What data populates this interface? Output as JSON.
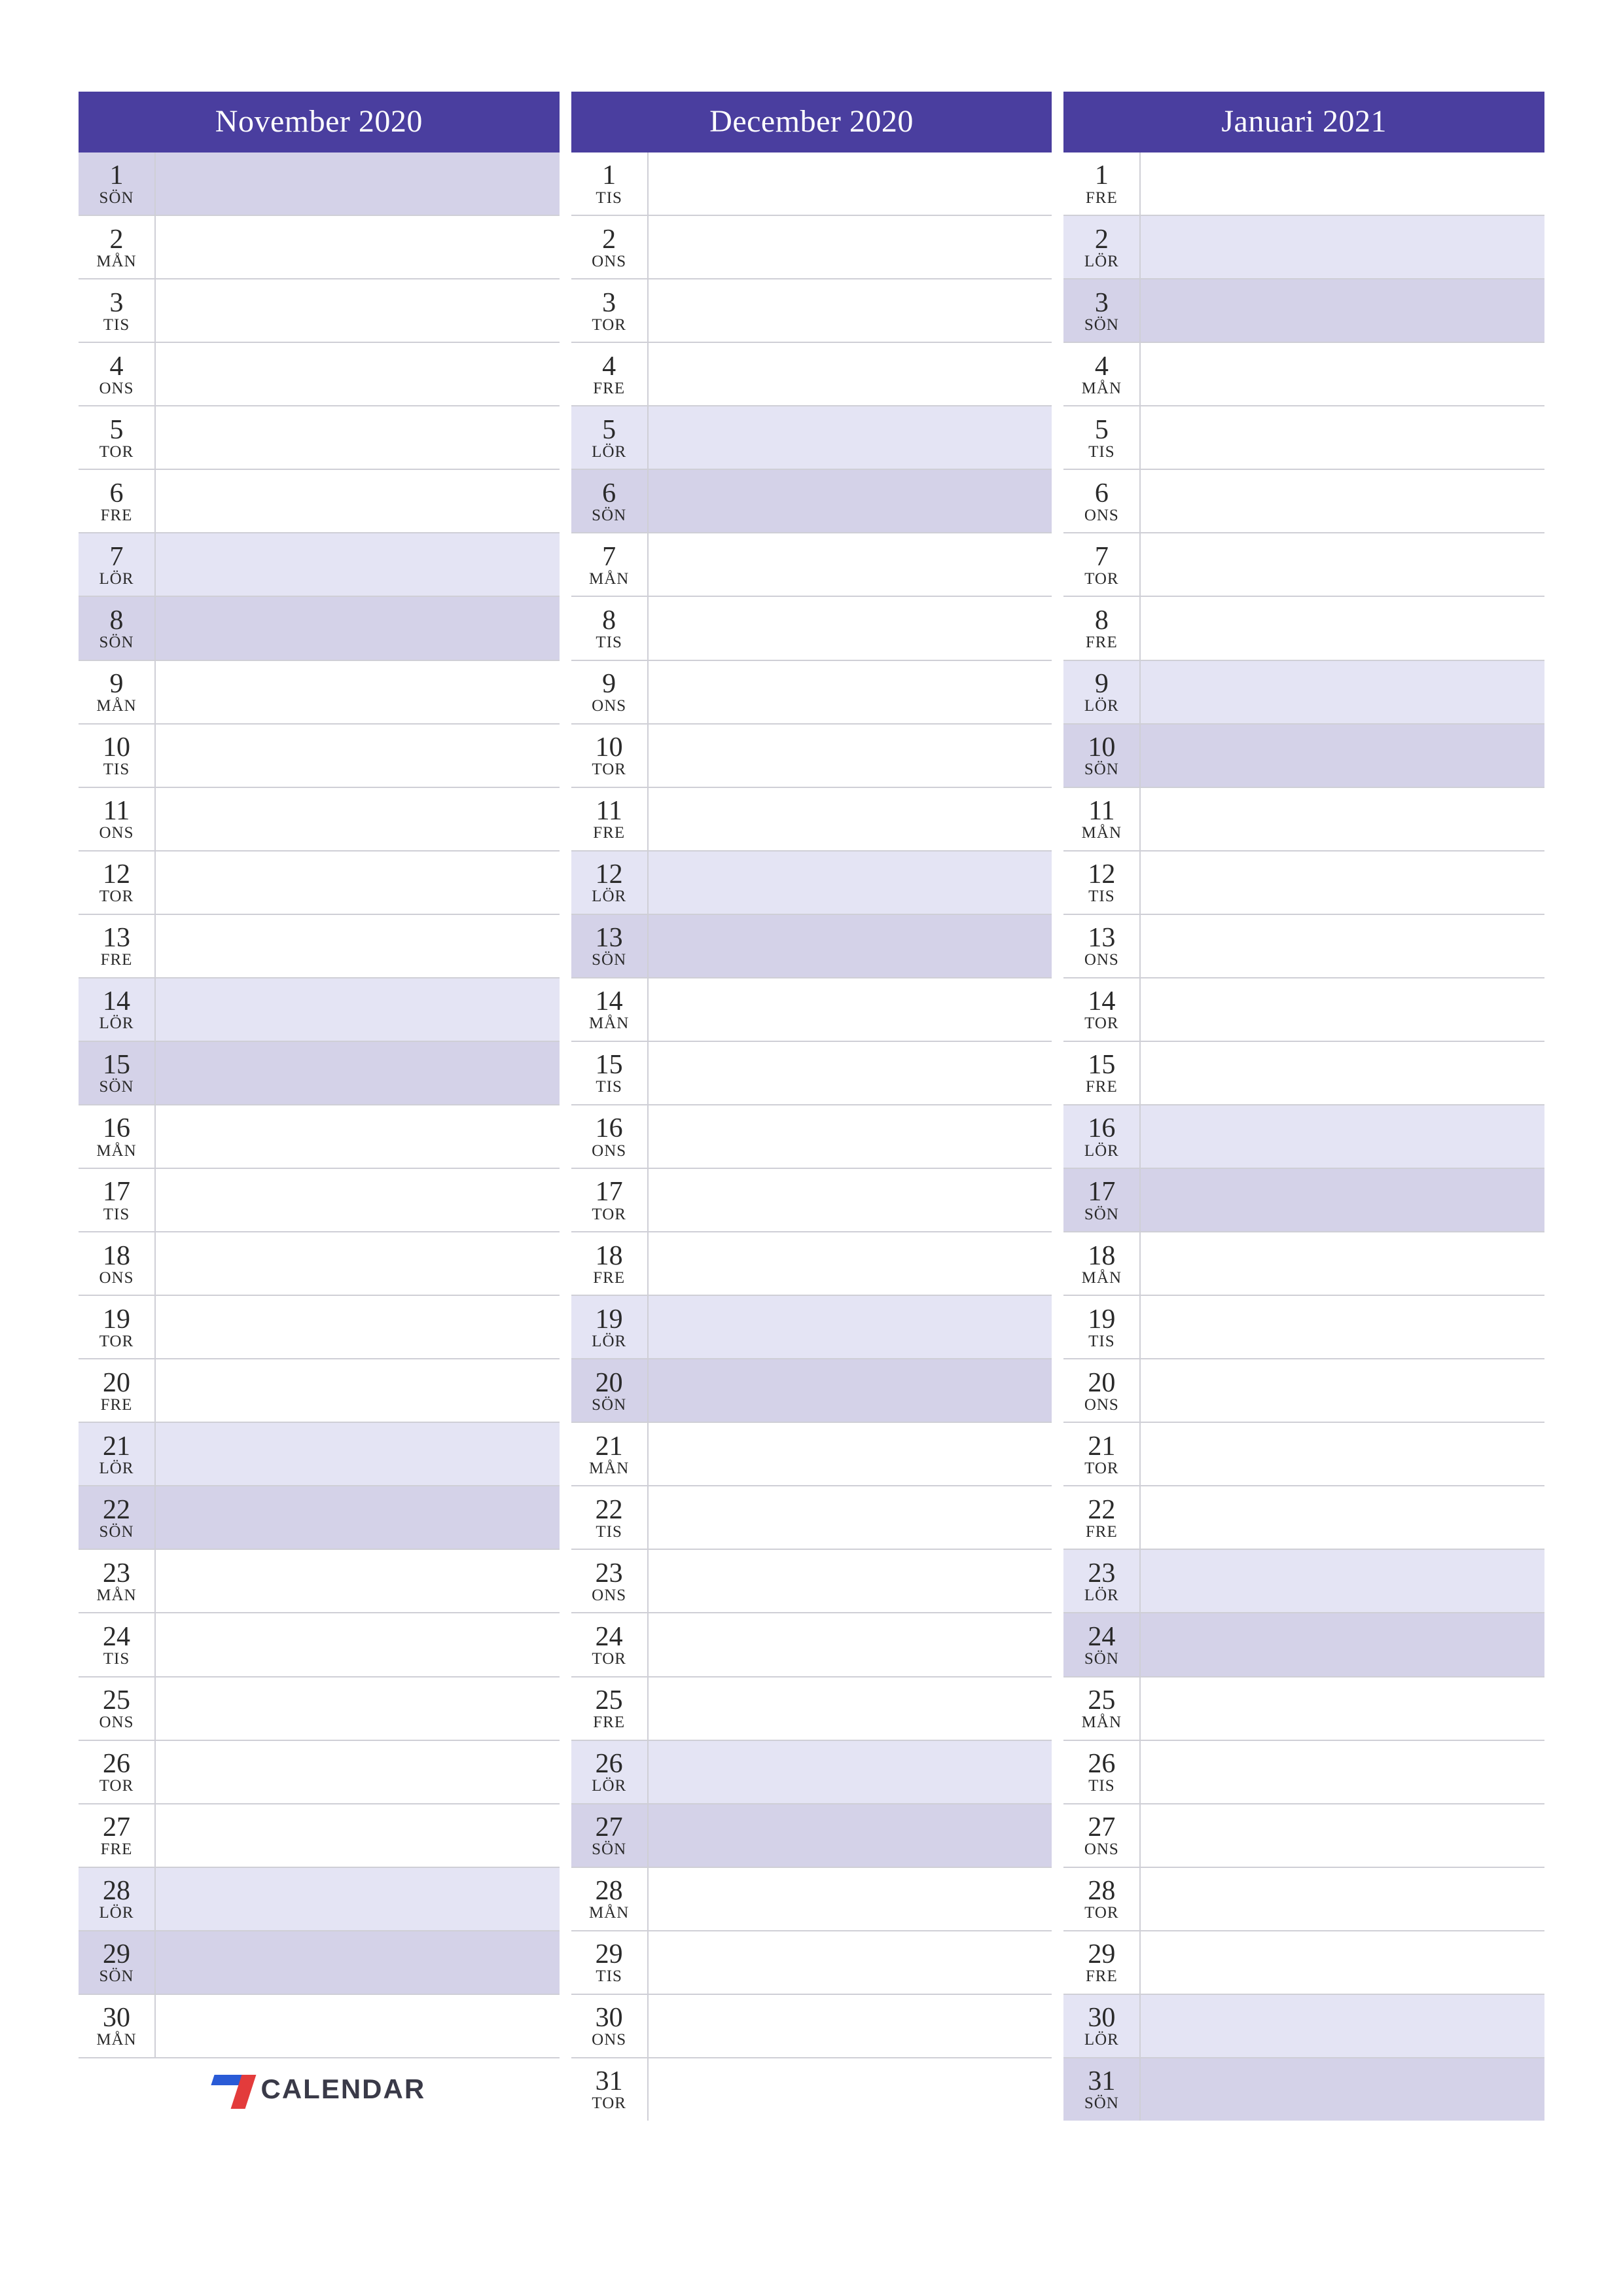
{
  "brand": {
    "name": "CALENDAR"
  },
  "colors": {
    "header_bg": "#4a3e9f",
    "sat_bg": "#e4e4f4",
    "sun_bg": "#d4d2e8"
  },
  "weekdays": {
    "mon": "MÅN",
    "tue": "TIS",
    "wed": "ONS",
    "thu": "TOR",
    "fri": "FRE",
    "sat": "LÖR",
    "sun": "SÖN"
  },
  "months": [
    {
      "title": "November 2020",
      "show_logo": true,
      "days": [
        {
          "n": 1,
          "w": "SÖN",
          "t": "sun"
        },
        {
          "n": 2,
          "w": "MÅN",
          "t": ""
        },
        {
          "n": 3,
          "w": "TIS",
          "t": ""
        },
        {
          "n": 4,
          "w": "ONS",
          "t": ""
        },
        {
          "n": 5,
          "w": "TOR",
          "t": ""
        },
        {
          "n": 6,
          "w": "FRE",
          "t": ""
        },
        {
          "n": 7,
          "w": "LÖR",
          "t": "sat"
        },
        {
          "n": 8,
          "w": "SÖN",
          "t": "sun"
        },
        {
          "n": 9,
          "w": "MÅN",
          "t": ""
        },
        {
          "n": 10,
          "w": "TIS",
          "t": ""
        },
        {
          "n": 11,
          "w": "ONS",
          "t": ""
        },
        {
          "n": 12,
          "w": "TOR",
          "t": ""
        },
        {
          "n": 13,
          "w": "FRE",
          "t": ""
        },
        {
          "n": 14,
          "w": "LÖR",
          "t": "sat"
        },
        {
          "n": 15,
          "w": "SÖN",
          "t": "sun"
        },
        {
          "n": 16,
          "w": "MÅN",
          "t": ""
        },
        {
          "n": 17,
          "w": "TIS",
          "t": ""
        },
        {
          "n": 18,
          "w": "ONS",
          "t": ""
        },
        {
          "n": 19,
          "w": "TOR",
          "t": ""
        },
        {
          "n": 20,
          "w": "FRE",
          "t": ""
        },
        {
          "n": 21,
          "w": "LÖR",
          "t": "sat"
        },
        {
          "n": 22,
          "w": "SÖN",
          "t": "sun"
        },
        {
          "n": 23,
          "w": "MÅN",
          "t": ""
        },
        {
          "n": 24,
          "w": "TIS",
          "t": ""
        },
        {
          "n": 25,
          "w": "ONS",
          "t": ""
        },
        {
          "n": 26,
          "w": "TOR",
          "t": ""
        },
        {
          "n": 27,
          "w": "FRE",
          "t": ""
        },
        {
          "n": 28,
          "w": "LÖR",
          "t": "sat"
        },
        {
          "n": 29,
          "w": "SÖN",
          "t": "sun"
        },
        {
          "n": 30,
          "w": "MÅN",
          "t": ""
        }
      ]
    },
    {
      "title": "December 2020",
      "show_logo": false,
      "days": [
        {
          "n": 1,
          "w": "TIS",
          "t": ""
        },
        {
          "n": 2,
          "w": "ONS",
          "t": ""
        },
        {
          "n": 3,
          "w": "TOR",
          "t": ""
        },
        {
          "n": 4,
          "w": "FRE",
          "t": ""
        },
        {
          "n": 5,
          "w": "LÖR",
          "t": "sat"
        },
        {
          "n": 6,
          "w": "SÖN",
          "t": "sun"
        },
        {
          "n": 7,
          "w": "MÅN",
          "t": ""
        },
        {
          "n": 8,
          "w": "TIS",
          "t": ""
        },
        {
          "n": 9,
          "w": "ONS",
          "t": ""
        },
        {
          "n": 10,
          "w": "TOR",
          "t": ""
        },
        {
          "n": 11,
          "w": "FRE",
          "t": ""
        },
        {
          "n": 12,
          "w": "LÖR",
          "t": "sat"
        },
        {
          "n": 13,
          "w": "SÖN",
          "t": "sun"
        },
        {
          "n": 14,
          "w": "MÅN",
          "t": ""
        },
        {
          "n": 15,
          "w": "TIS",
          "t": ""
        },
        {
          "n": 16,
          "w": "ONS",
          "t": ""
        },
        {
          "n": 17,
          "w": "TOR",
          "t": ""
        },
        {
          "n": 18,
          "w": "FRE",
          "t": ""
        },
        {
          "n": 19,
          "w": "LÖR",
          "t": "sat"
        },
        {
          "n": 20,
          "w": "SÖN",
          "t": "sun"
        },
        {
          "n": 21,
          "w": "MÅN",
          "t": ""
        },
        {
          "n": 22,
          "w": "TIS",
          "t": ""
        },
        {
          "n": 23,
          "w": "ONS",
          "t": ""
        },
        {
          "n": 24,
          "w": "TOR",
          "t": ""
        },
        {
          "n": 25,
          "w": "FRE",
          "t": ""
        },
        {
          "n": 26,
          "w": "LÖR",
          "t": "sat"
        },
        {
          "n": 27,
          "w": "SÖN",
          "t": "sun"
        },
        {
          "n": 28,
          "w": "MÅN",
          "t": ""
        },
        {
          "n": 29,
          "w": "TIS",
          "t": ""
        },
        {
          "n": 30,
          "w": "ONS",
          "t": ""
        },
        {
          "n": 31,
          "w": "TOR",
          "t": ""
        }
      ]
    },
    {
      "title": "Januari 2021",
      "show_logo": false,
      "days": [
        {
          "n": 1,
          "w": "FRE",
          "t": ""
        },
        {
          "n": 2,
          "w": "LÖR",
          "t": "sat"
        },
        {
          "n": 3,
          "w": "SÖN",
          "t": "sun"
        },
        {
          "n": 4,
          "w": "MÅN",
          "t": ""
        },
        {
          "n": 5,
          "w": "TIS",
          "t": ""
        },
        {
          "n": 6,
          "w": "ONS",
          "t": ""
        },
        {
          "n": 7,
          "w": "TOR",
          "t": ""
        },
        {
          "n": 8,
          "w": "FRE",
          "t": ""
        },
        {
          "n": 9,
          "w": "LÖR",
          "t": "sat"
        },
        {
          "n": 10,
          "w": "SÖN",
          "t": "sun"
        },
        {
          "n": 11,
          "w": "MÅN",
          "t": ""
        },
        {
          "n": 12,
          "w": "TIS",
          "t": ""
        },
        {
          "n": 13,
          "w": "ONS",
          "t": ""
        },
        {
          "n": 14,
          "w": "TOR",
          "t": ""
        },
        {
          "n": 15,
          "w": "FRE",
          "t": ""
        },
        {
          "n": 16,
          "w": "LÖR",
          "t": "sat"
        },
        {
          "n": 17,
          "w": "SÖN",
          "t": "sun"
        },
        {
          "n": 18,
          "w": "MÅN",
          "t": ""
        },
        {
          "n": 19,
          "w": "TIS",
          "t": ""
        },
        {
          "n": 20,
          "w": "ONS",
          "t": ""
        },
        {
          "n": 21,
          "w": "TOR",
          "t": ""
        },
        {
          "n": 22,
          "w": "FRE",
          "t": ""
        },
        {
          "n": 23,
          "w": "LÖR",
          "t": "sat"
        },
        {
          "n": 24,
          "w": "SÖN",
          "t": "sun"
        },
        {
          "n": 25,
          "w": "MÅN",
          "t": ""
        },
        {
          "n": 26,
          "w": "TIS",
          "t": ""
        },
        {
          "n": 27,
          "w": "ONS",
          "t": ""
        },
        {
          "n": 28,
          "w": "TOR",
          "t": ""
        },
        {
          "n": 29,
          "w": "FRE",
          "t": ""
        },
        {
          "n": 30,
          "w": "LÖR",
          "t": "sat"
        },
        {
          "n": 31,
          "w": "SÖN",
          "t": "sun"
        }
      ]
    }
  ]
}
